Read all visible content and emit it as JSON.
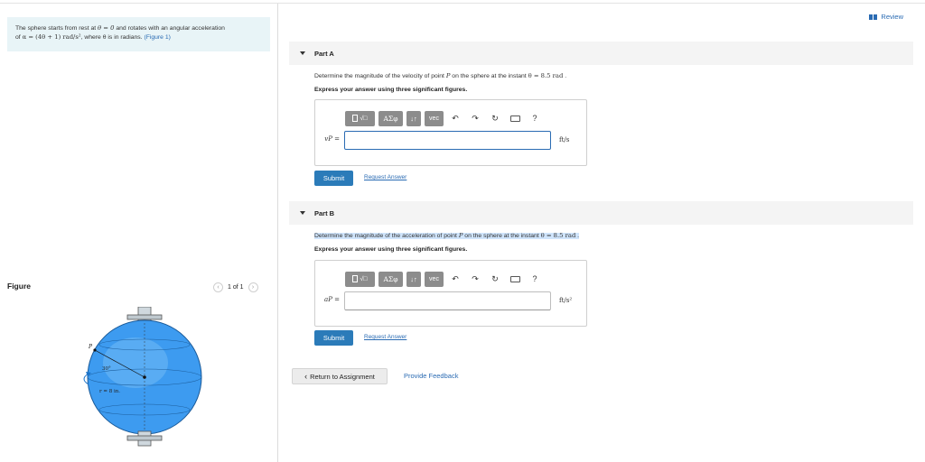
{
  "review": {
    "label": "Review"
  },
  "problem": {
    "line1_a": "The sphere starts from rest at ",
    "theta_eq": "θ = 0",
    "line1_b": "  and rotates with an angular acceleration",
    "line2_a": "of ",
    "alpha_expr": "α = (4θ + 1) rad/s²",
    "line2_b": ", where θ is in radians. ",
    "figure_link": "(Figure 1)"
  },
  "figure": {
    "title": "Figure",
    "pager": {
      "text": "1 of 1"
    },
    "labels": {
      "point": "P",
      "angle": "30°",
      "radius": "r = 8 in."
    },
    "sphere_color": "#3d9bf0"
  },
  "partA": {
    "title": "Part A",
    "question_a": "Determine the magnitude of the velocity of point ",
    "question_p": "P",
    "question_b": " on the sphere at the instant ",
    "question_theta": "θ = 8.5 rad",
    "question_end": " .",
    "instruction": "Express your answer using three significant figures.",
    "var_label": "vP =",
    "unit": "ft/s",
    "input_value": "",
    "submit_label": "Submit",
    "request_label": "Request Answer"
  },
  "partB": {
    "title": "Part B",
    "question_a": "Determine the magnitude of the acceleration of point ",
    "question_p": "P",
    "question_b": " on the sphere at the instant ",
    "question_theta": "θ = 8.5 rad",
    "question_end": " .",
    "instruction": "Express your answer using three significant figures.",
    "var_label": "aP =",
    "unit": "ft/s²",
    "input_value": "",
    "submit_label": "Submit",
    "request_label": "Request Answer"
  },
  "toolbar": {
    "greek_label": "ΑΣφ",
    "arrows_label": "↓↑",
    "vec_label": "vec",
    "help_label": "?",
    "icons": [
      "templates-icon",
      "greek-icon",
      "arrows-icon",
      "vec-icon",
      "undo-icon",
      "redo-icon",
      "reset-icon",
      "keyboard-icon",
      "help-icon"
    ]
  },
  "footer": {
    "return_label": "Return to Assignment",
    "feedback_label": "Provide Feedback"
  },
  "colors": {
    "accent": "#2b7bb9",
    "statement_bg": "#e8f4f7",
    "toolbar_btn": "#8c8c8c",
    "highlight": "#cfe4fb"
  }
}
